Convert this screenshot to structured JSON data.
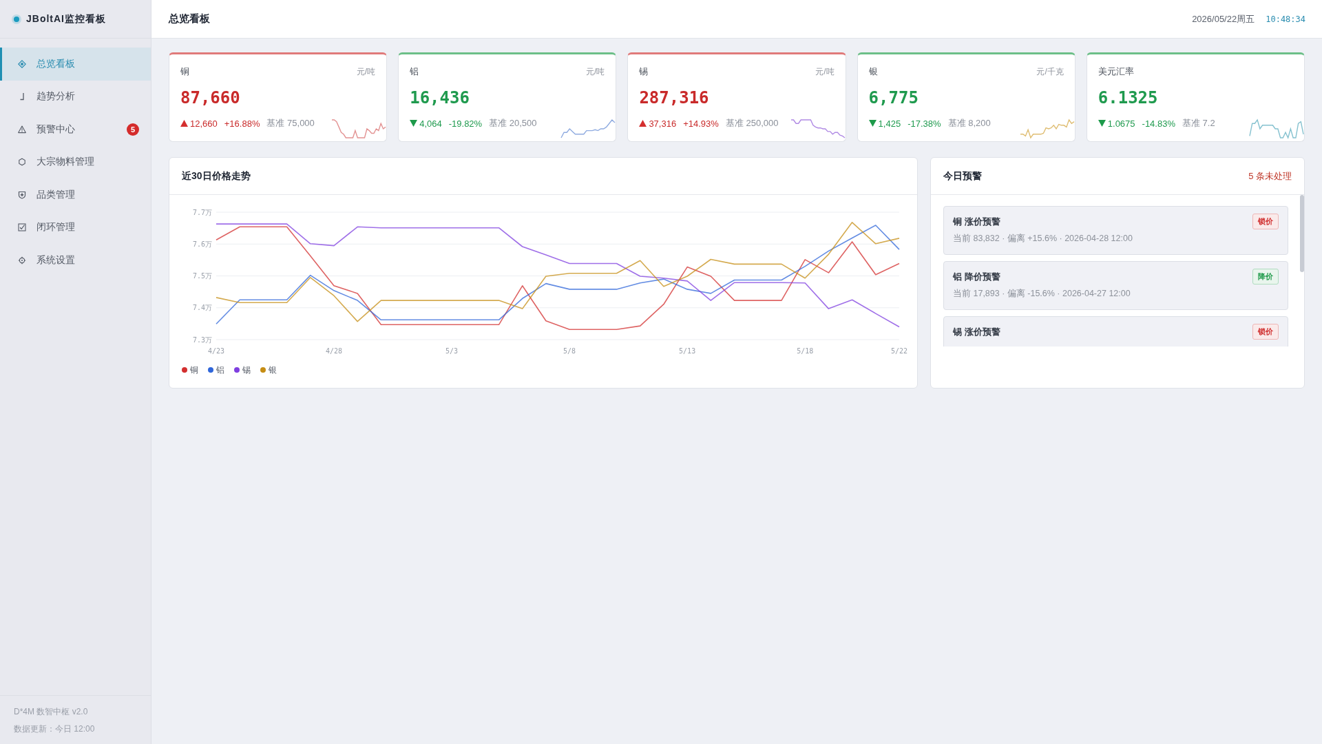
{
  "sidebar": {
    "logo": "JBoltAI监控看板",
    "items": [
      {
        "label": "总览看板",
        "selected": true
      },
      {
        "label": "趋势分析",
        "selected": false
      },
      {
        "label": "预警中心",
        "selected": false,
        "badge": "5"
      },
      {
        "label": "大宗物料管理",
        "selected": false
      },
      {
        "label": "品类管理",
        "selected": false
      },
      {
        "label": "闭环管理",
        "selected": false
      },
      {
        "label": "系统设置",
        "selected": false
      }
    ],
    "footer": [
      "D*4M 数智中枢 v2.0",
      "数据更新：今日 12:00"
    ]
  },
  "header": {
    "title": "总览看板",
    "date": "2026/05/22周五",
    "time": "10:48:34"
  },
  "cards": [
    {
      "name": "铜",
      "unit": "元/吨",
      "value": "87,660",
      "rising": true,
      "change": "12,660",
      "percent": "+16.88%",
      "baseline": "基准 75,000",
      "color": "#e39393"
    },
    {
      "name": "铝",
      "unit": "元/吨",
      "value": "16,436",
      "rising": false,
      "change": "4,064",
      "percent": "-19.82%",
      "baseline": "基准 20,500",
      "color": "#8fabe0"
    },
    {
      "name": "锡",
      "unit": "元/吨",
      "value": "287,316",
      "rising": true,
      "change": "37,316",
      "percent": "+14.93%",
      "baseline": "基准 250,000",
      "color": "#b08ae4"
    },
    {
      "name": "银",
      "unit": "元/千克",
      "value": "6,775",
      "rising": false,
      "change": "1,425",
      "percent": "-17.38%",
      "baseline": "基准 8,200",
      "color": "#dfbd72"
    },
    {
      "name": "美元汇率",
      "value": "6.1325",
      "rising": false,
      "change": "1.0675",
      "percent": "-14.83%",
      "baseline": "基准 7.2",
      "color": "#84c1cf"
    }
  ],
  "trend_panel": {
    "title": "近30日价格走势",
    "chart_data": {
      "type": "line",
      "grid": true,
      "categories": [
        "4/23",
        null,
        null,
        null,
        null,
        "4/28",
        null,
        null,
        null,
        null,
        "5/3",
        null,
        null,
        null,
        null,
        "5/8",
        null,
        null,
        null,
        null,
        "5/13",
        null,
        null,
        null,
        null,
        "5/18",
        null,
        null,
        null,
        "5/22"
      ],
      "ylim": [
        7.3,
        7.7
      ],
      "yticks": [
        {
          "value": 7.3,
          "label": "7.3万"
        },
        {
          "value": 7.4,
          "label": "7.4万"
        },
        {
          "value": 7.5,
          "label": "7.5万"
        },
        {
          "value": 7.6,
          "label": "7.6万"
        },
        {
          "value": 7.7,
          "label": "7.7万"
        }
      ],
      "series": [
        {
          "name": "铜",
          "color": "#d32f2f",
          "values": [
            7.613,
            7.654,
            7.654,
            7.654,
            7.563,
            7.469,
            7.445,
            7.347,
            7.347,
            7.347,
            7.347,
            7.347,
            7.347,
            7.469,
            7.359,
            7.332,
            7.332,
            7.332,
            7.343,
            7.411,
            7.528,
            7.499,
            7.423,
            7.423,
            7.423,
            7.551,
            7.51,
            7.607,
            7.504,
            7.539
          ]
        },
        {
          "name": "铝",
          "color": "#2f66da",
          "values": [
            7.349,
            7.425,
            7.425,
            7.425,
            7.502,
            7.454,
            7.423,
            7.362,
            7.362,
            7.362,
            7.362,
            7.362,
            7.362,
            7.429,
            7.476,
            7.458,
            7.458,
            7.458,
            7.478,
            7.49,
            7.458,
            7.445,
            7.487,
            7.487,
            7.487,
            7.53,
            7.578,
            7.619,
            7.659,
            7.583
          ]
        },
        {
          "name": "锡",
          "color": "#7f3fe0",
          "values": [
            7.663,
            7.663,
            7.663,
            7.663,
            7.601,
            7.595,
            7.654,
            7.651,
            7.651,
            7.651,
            7.651,
            7.651,
            7.651,
            7.592,
            7.566,
            7.539,
            7.539,
            7.539,
            7.499,
            7.493,
            7.484,
            7.423,
            7.479,
            7.479,
            7.479,
            7.478,
            7.397,
            7.425,
            7.382,
            7.34
          ]
        },
        {
          "name": "银",
          "color": "#c68d14",
          "values": [
            7.432,
            7.416,
            7.416,
            7.416,
            7.495,
            7.438,
            7.357,
            7.423,
            7.423,
            7.423,
            7.423,
            7.423,
            7.423,
            7.397,
            7.499,
            7.508,
            7.508,
            7.508,
            7.548,
            7.467,
            7.499,
            7.552,
            7.537,
            7.537,
            7.537,
            7.493,
            7.568,
            7.668,
            7.601,
            7.618
          ]
        }
      ]
    }
  },
  "alerts_panel": {
    "title": "今日预警",
    "count": "5 条未处理",
    "items": [
      {
        "title": "铜 涨价预警",
        "detail": "当前 83,832 · 偏离 +15.6% · 2026-04-28 12:00",
        "badge": {
          "label": "锁价",
          "color": "#cf2d2d"
        }
      },
      {
        "title": "铝 降价预警",
        "detail": "当前 17,893 · 偏离 -15.6% · 2026-04-27 12:00",
        "badge": {
          "label": "降价",
          "color": "#1e9a4a"
        }
      },
      {
        "title": "锡 涨价预警",
        "badge": {
          "label": "锁价",
          "color": "#cf2d2d"
        }
      }
    ]
  }
}
